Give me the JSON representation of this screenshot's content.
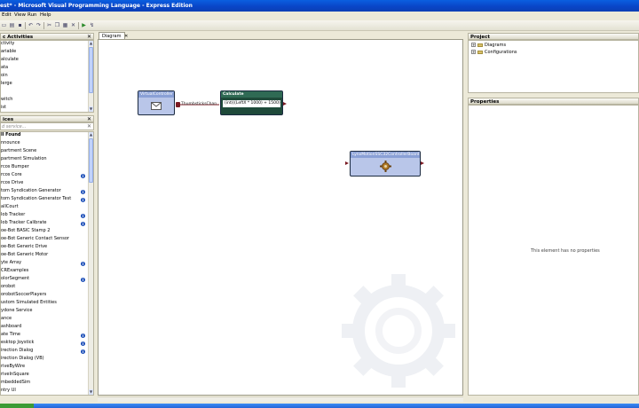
{
  "window": {
    "title": "est* - Microsoft Visual Programming Language - Express Edition"
  },
  "menu": [
    "Edit",
    "View",
    "Run",
    "Help"
  ],
  "activities_panel": {
    "title": "c Activities",
    "items": [
      "ctivity",
      "ariable",
      "alculate",
      "ata",
      "oin",
      "lerge",
      "",
      "witch",
      "ist"
    ]
  },
  "services_panel": {
    "title": "ices",
    "search_placeholder": "d service...",
    "items": [
      {
        "label": "ll Found",
        "info": false,
        "bold": true
      },
      {
        "label": "nnounce",
        "info": false
      },
      {
        "label": "partment Scene",
        "info": false
      },
      {
        "label": "partment Simulation",
        "info": false
      },
      {
        "label": "rcos Bumper",
        "info": false
      },
      {
        "label": "rcos Core",
        "info": true
      },
      {
        "label": "rcos Drive",
        "info": false
      },
      {
        "label": "tom Syndication Generator",
        "info": true
      },
      {
        "label": "tom Syndication Generator Test",
        "info": true
      },
      {
        "label": "allCourt",
        "info": false
      },
      {
        "label": "lob Tracker",
        "info": true
      },
      {
        "label": "lob Tracker Calibrate",
        "info": true
      },
      {
        "label": "oe-Bot BASIC Stamp 2",
        "info": false
      },
      {
        "label": "oe-Bot Generic Contact Sensor",
        "info": false
      },
      {
        "label": "oe-Bot Generic Drive",
        "info": false
      },
      {
        "label": "oe-Bot Generic Motor",
        "info": false
      },
      {
        "label": "yte Array",
        "info": true
      },
      {
        "label": "CRExamples",
        "info": false
      },
      {
        "label": "olorSegment",
        "info": true
      },
      {
        "label": "orobot",
        "info": false
      },
      {
        "label": "orobotSoccerPlayers",
        "info": false
      },
      {
        "label": "ustom Simulated Entities",
        "info": false
      },
      {
        "label": "ydone Service",
        "info": false
      },
      {
        "label": "ance",
        "info": false
      },
      {
        "label": "ashboard",
        "info": false
      },
      {
        "label": "ate Time",
        "info": true
      },
      {
        "label": "esktop Joystick",
        "info": true
      },
      {
        "label": "irection Dialog",
        "info": true
      },
      {
        "label": "irection Dialog (VB)",
        "info": false
      },
      {
        "label": "riveByWire",
        "info": false
      },
      {
        "label": "riveInSquare",
        "info": false
      },
      {
        "label": "mbeddedSim",
        "info": false
      },
      {
        "label": "ntry UI",
        "info": false
      }
    ]
  },
  "diagram": {
    "tab_label": "Diagram",
    "tab_close": "✕",
    "nodes": {
      "virtual_controller": {
        "title": "VirtualController"
      },
      "calculate": {
        "title": "Calculate",
        "expression": "(int)((LeftX * 1000) + 1500)"
      },
      "service": {
        "title": "LynxMotionSSC32ControllerBoard"
      }
    },
    "wire_label": "ThumbsticksChan"
  },
  "project_panel": {
    "title": "Project",
    "items": [
      "Diagrams",
      "Configurations"
    ]
  },
  "properties_panel": {
    "title": "Properties",
    "empty_text": "This element has no properties"
  },
  "colors": {
    "node_blue": "#b9c6e9",
    "node_title_blue": "#33477a",
    "calc_body": "#1f4a3a",
    "titlebar": "#0a4ed4"
  }
}
